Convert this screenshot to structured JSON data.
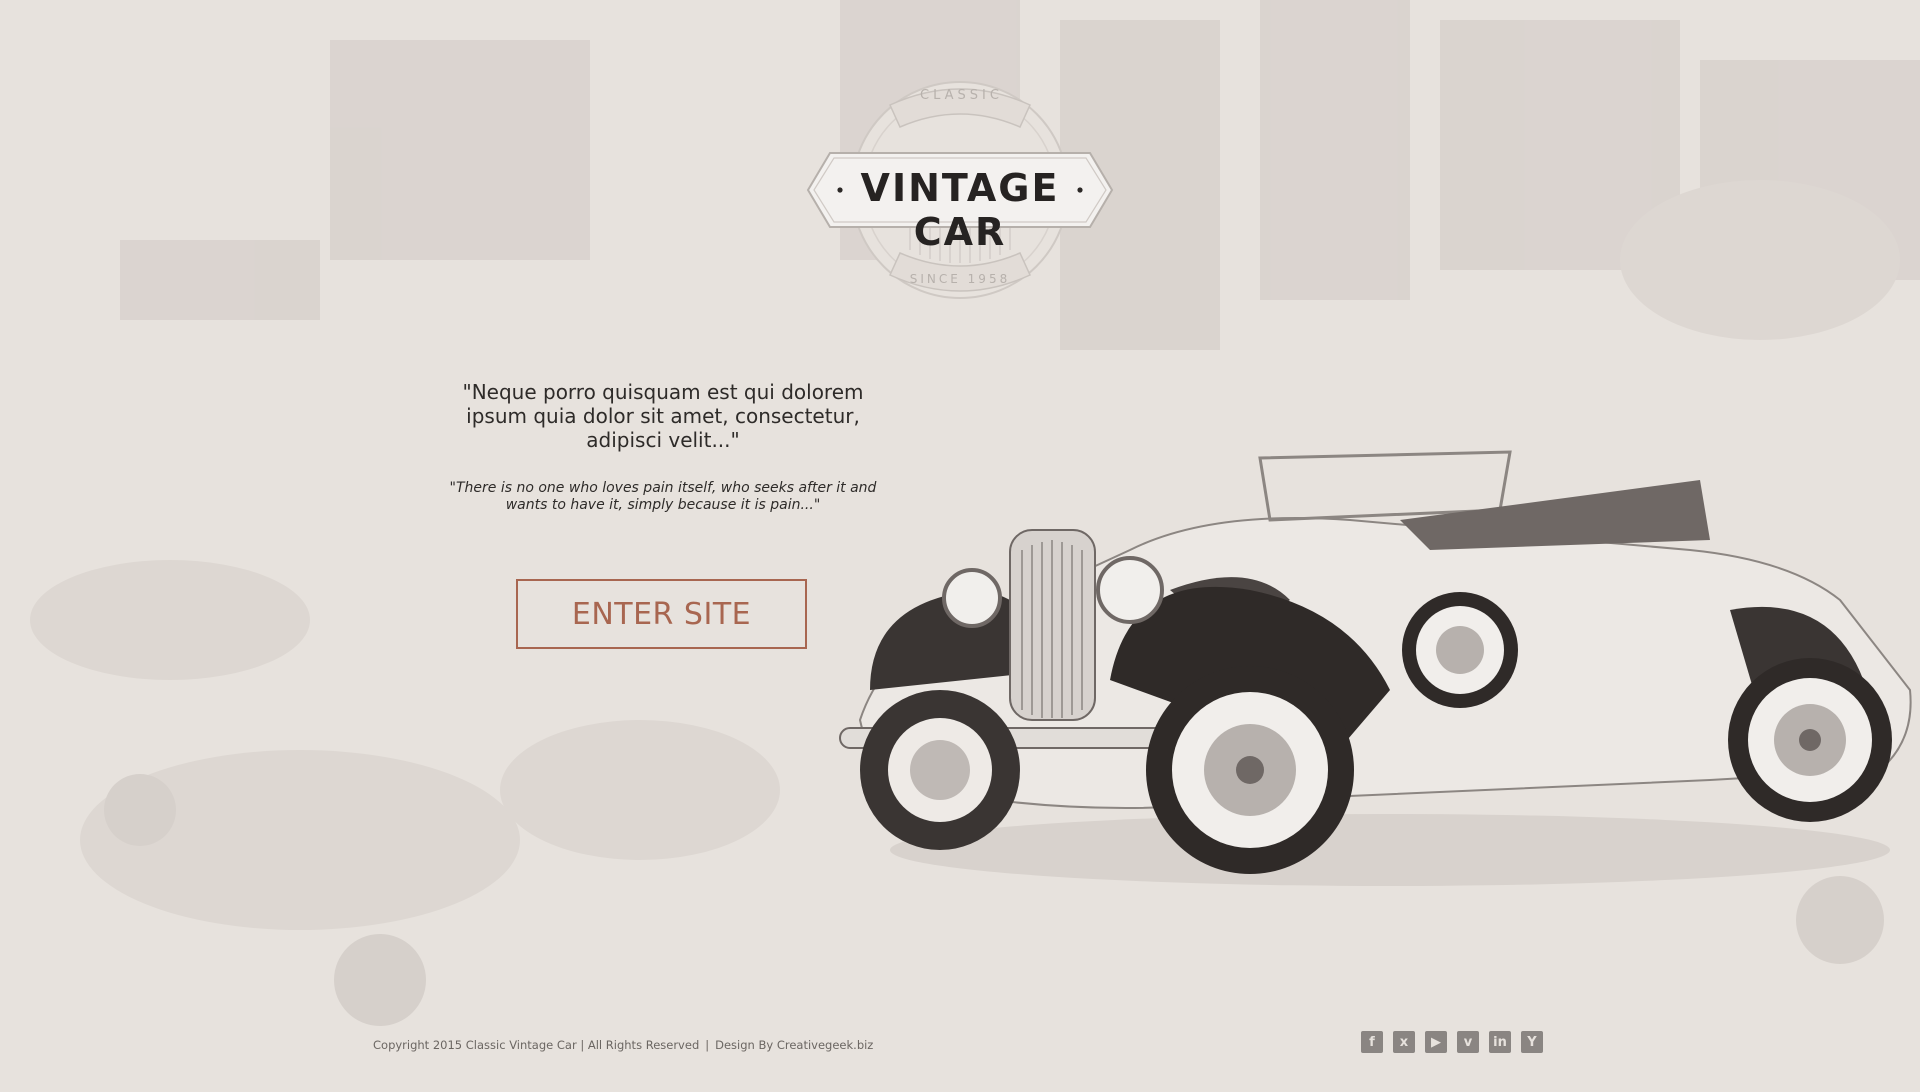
{
  "logo": {
    "top_text": "CLASSIC",
    "brand": "VINTAGE CAR",
    "bottom_text": "SINCE 1958"
  },
  "hero": {
    "quote_main": "\"Neque porro quisquam est qui dolorem ipsum quia dolor sit amet, consectetur, adipisci velit...\"",
    "quote_sub": "\"There is no one who loves pain itself, who seeks after it and wants to have it, simply because it is pain...\""
  },
  "cta": {
    "label": "ENTER SITE"
  },
  "footer": {
    "copyright": "Copyright 2015 Classic Vintage Car | All Rights Reserved",
    "separator": "|",
    "design_credit": "Design By Creativegeek.biz"
  },
  "social": [
    {
      "name": "facebook-icon",
      "glyph": "f"
    },
    {
      "name": "xing-icon",
      "glyph": "x"
    },
    {
      "name": "youtube-icon",
      "glyph": "▶"
    },
    {
      "name": "vimeo-icon",
      "glyph": "v"
    },
    {
      "name": "linkedin-icon",
      "glyph": "in"
    },
    {
      "name": "hacker-news-icon",
      "glyph": "Y"
    }
  ],
  "colors": {
    "background": "#e7e2dd",
    "accent": "#a86650",
    "text": "#2e2b29",
    "footer_text": "#6b6662",
    "icon": "#8a8582"
  }
}
